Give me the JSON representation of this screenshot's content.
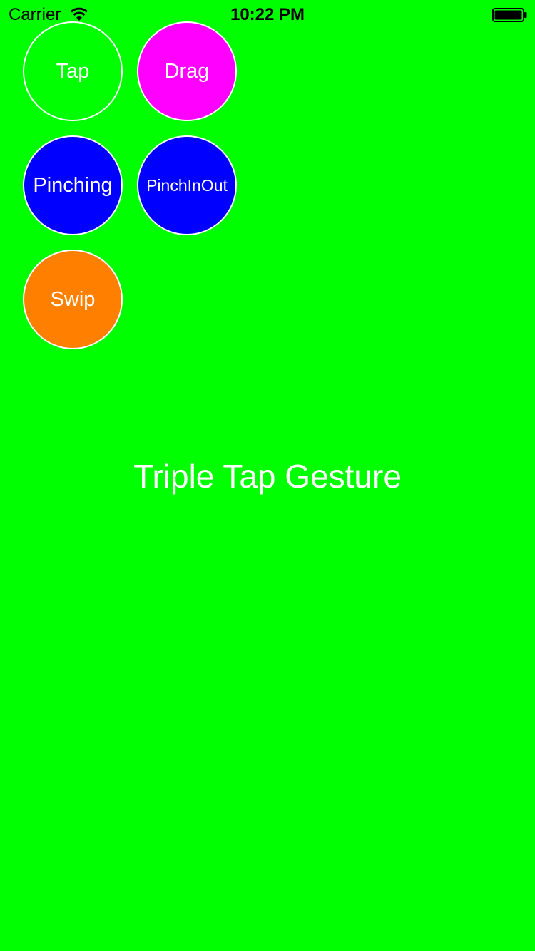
{
  "status_bar": {
    "carrier": "Carrier",
    "time": "10:22 PM",
    "wifi_icon": "wifi-icon",
    "battery_icon": "battery-icon"
  },
  "buttons": {
    "tap": {
      "label": "Tap",
      "color": "#00ff00"
    },
    "drag": {
      "label": "Drag",
      "color": "#ff00ff"
    },
    "pinching": {
      "label": "Pinching",
      "color": "#0000ff"
    },
    "pinchinout": {
      "label": "PinchInOut",
      "color": "#0000ff"
    },
    "swip": {
      "label": "Swip",
      "color": "#ff8000"
    }
  },
  "gesture_label": "Triple Tap Gesture",
  "colors": {
    "background": "#00ff00",
    "text": "#ffffff"
  }
}
